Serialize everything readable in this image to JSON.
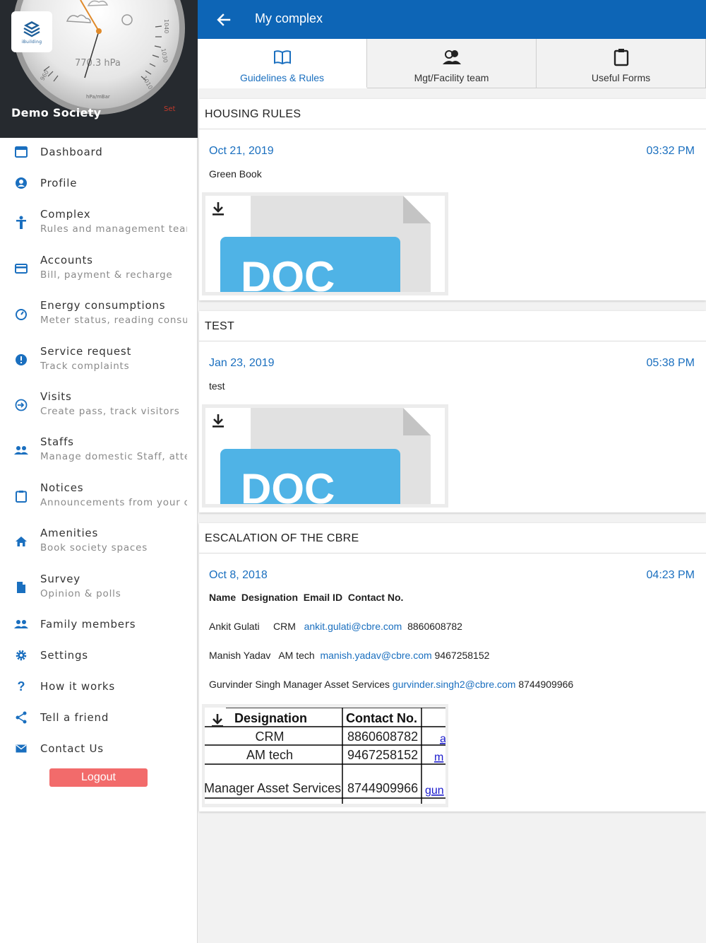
{
  "drawer": {
    "society_name": "Demo Society",
    "gauge_reading": "770.3 hPa",
    "gauge_unit": "hPa/mBar",
    "gauge_set_label": "Set",
    "logo_text": "iBuilding"
  },
  "menu": [
    {
      "label": "Dashboard",
      "sub": "",
      "icon": "dashboard-icon"
    },
    {
      "label": "Profile",
      "sub": "",
      "icon": "profile-icon"
    },
    {
      "label": "Complex",
      "sub": "Rules and management team",
      "icon": "complex-icon"
    },
    {
      "label": "Accounts",
      "sub": "Bill, payment & recharge",
      "icon": "card-icon"
    },
    {
      "label": "Energy consumptions",
      "sub": "Meter status, reading consumption",
      "icon": "meter-icon"
    },
    {
      "label": "Service request",
      "sub": "Track complaints",
      "icon": "alert-icon"
    },
    {
      "label": "Visits",
      "sub": "Create pass, track visitors",
      "icon": "login-icon"
    },
    {
      "label": "Staffs",
      "sub": "Manage domestic Staff, attendance",
      "icon": "staff-icon"
    },
    {
      "label": "Notices",
      "sub": "Announcements from your complex",
      "icon": "clipboard-icon"
    },
    {
      "label": "Amenities",
      "sub": "Book society spaces",
      "icon": "home-icon"
    },
    {
      "label": "Survey",
      "sub": "Opinion & polls",
      "icon": "document-icon"
    },
    {
      "label": "Family members",
      "sub": "",
      "icon": "family-icon"
    },
    {
      "label": "Settings",
      "sub": "",
      "icon": "gear-icon"
    },
    {
      "label": "How it works",
      "sub": "",
      "icon": "question-icon"
    },
    {
      "label": "Tell a friend",
      "sub": "",
      "icon": "share-icon"
    },
    {
      "label": "Contact Us",
      "sub": "",
      "icon": "mail-icon"
    }
  ],
  "logout_label": "Logout",
  "appbar": {
    "title": "My complex"
  },
  "tabs": [
    {
      "label": "Guidelines & Rules",
      "active": true
    },
    {
      "label": "Mgt/Facility team",
      "active": false
    },
    {
      "label": "Useful Forms",
      "active": false
    }
  ],
  "posts": [
    {
      "title": "HOUSING RULES",
      "date": "Oct 21, 2019",
      "time": "03:32 PM",
      "text": "Green Book",
      "doc_label": "DOC"
    },
    {
      "title": "TEST",
      "date": "Jan 23, 2019",
      "time": "05:38 PM",
      "text": "test",
      "doc_label": "DOC"
    },
    {
      "title": "ESCALATION OF THE CBRE",
      "date": "Oct 8, 2018",
      "time": "04:23 PM",
      "header_line": "Name  Designation  Email ID  Contact No.",
      "contacts": [
        {
          "name": "Ankit Gulati",
          "designation": "CRM",
          "email": "ankit.gulati@cbre.com",
          "phone": "8860608782"
        },
        {
          "name": "Manish Yadav",
          "designation": "AM tech",
          "email": "manish.yadav@cbre.com",
          "phone": "9467258152"
        },
        {
          "name": "Gurvinder Singh",
          "designation": "Manager Asset Services",
          "email": "gurvinder.singh2@cbre.com",
          "phone": "8744909966"
        }
      ],
      "table": {
        "headers": [
          "Designation",
          "Contact No."
        ],
        "rows": [
          {
            "designation": "CRM",
            "phone": "8860608782",
            "link": "a"
          },
          {
            "designation": "AM tech",
            "phone": "9467258152",
            "link": "m"
          },
          {
            "designation": "Manager Asset Services",
            "phone": "8744909966",
            "link": "gun"
          }
        ]
      }
    }
  ],
  "colors": {
    "primary": "#0d65b6",
    "accent": "#1a6fbf",
    "logout": "#f26b6b",
    "drawer_header": "#262a2f"
  }
}
